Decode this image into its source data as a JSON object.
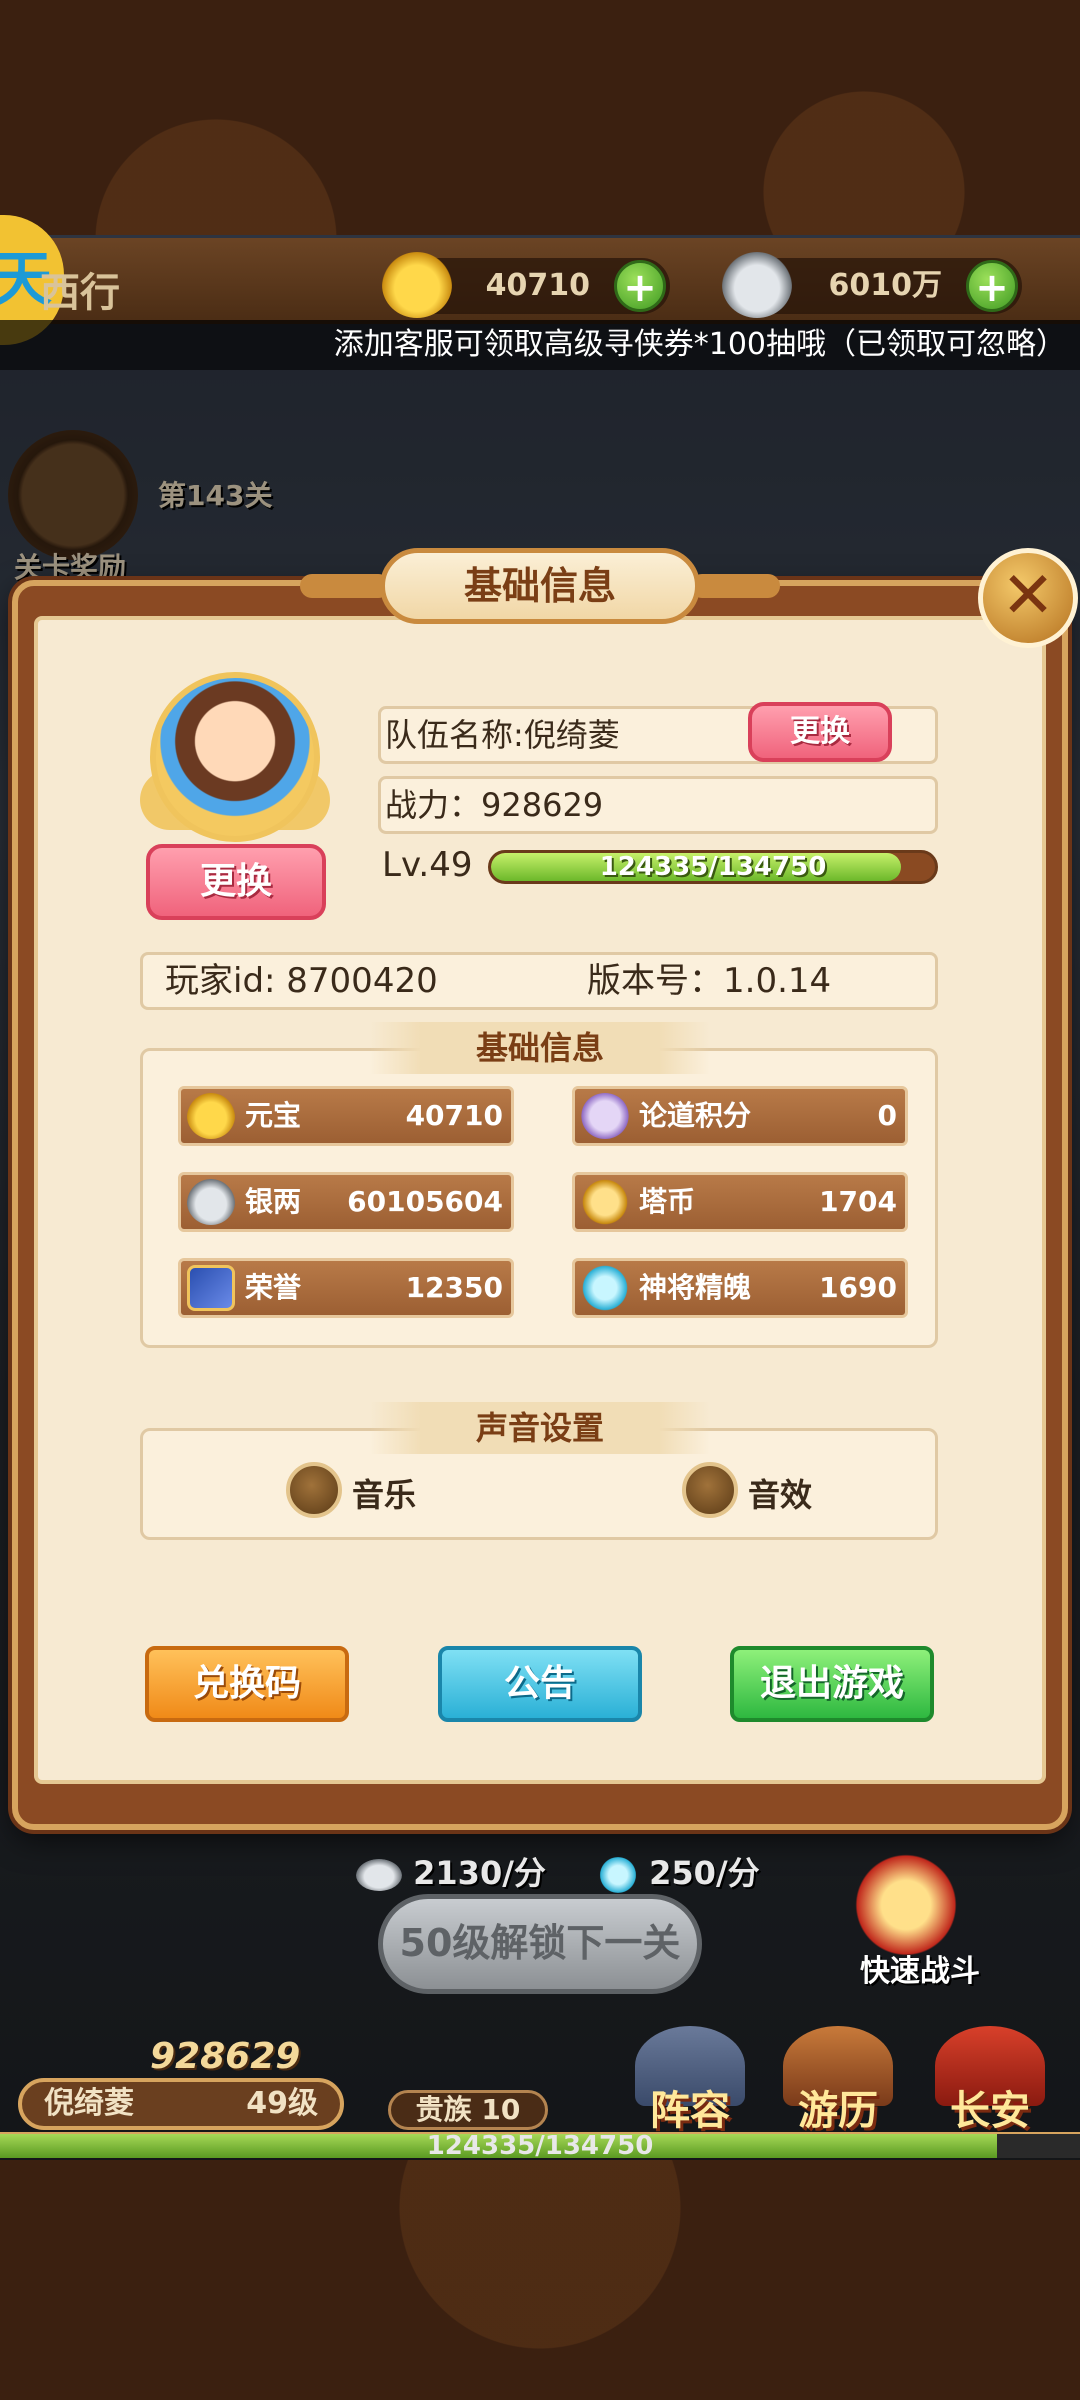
{
  "top_bar": {
    "logo_char": "天",
    "game_name": "西行",
    "gold": "40710",
    "silver": "6010万",
    "plus": "+"
  },
  "notice": "添加客服可领取高级寻侠券*100抽哦（已领取可忽略）",
  "map": {
    "stage_label": "第143关",
    "reward_label": "关卡奖励"
  },
  "modal": {
    "title": "基础信息",
    "close": "✕",
    "avatar_change_label": "更换",
    "team_name": "队伍名称:倪绮菱",
    "team_change_label": "更换",
    "power": "战力：928629",
    "level": "Lv.49",
    "exp_text": "124335/134750",
    "exp_fraction": 0.9227,
    "player_id": "玩家id: 8700420",
    "version": "版本号：1.0.14",
    "section_basic": "基础信息",
    "resources": [
      {
        "name": "元宝",
        "value": "40710",
        "icon": "gold-ingot-icon"
      },
      {
        "name": "论道积分",
        "value": "0",
        "icon": "debate-points-icon"
      },
      {
        "name": "银两",
        "value": "60105604",
        "icon": "silver-ingot-icon"
      },
      {
        "name": "塔币",
        "value": "1704",
        "icon": "tower-coin-icon"
      },
      {
        "name": "荣誉",
        "value": "12350",
        "icon": "honor-icon"
      },
      {
        "name": "神将精魄",
        "value": "1690",
        "icon": "spirit-crystal-icon"
      }
    ],
    "section_sound": "声音设置",
    "music_label": "音乐",
    "sfx_label": "音效",
    "redeem_label": "兑换码",
    "announce_label": "公告",
    "exit_label": "退出游戏"
  },
  "hud": {
    "silver_rate": "2130/分",
    "exp_rate": "250/分",
    "unlock_label": "50级解锁下一关",
    "quick_battle": "快速战斗",
    "power": "928629",
    "player_name": "倪绮菱",
    "player_level": "49级",
    "noble": "贵族 10",
    "exp_text": "124335/134750",
    "exp_fraction": 0.9227,
    "nav": [
      {
        "label": "阵容",
        "icon": "formation-icon"
      },
      {
        "label": "游历",
        "icon": "travel-icon"
      },
      {
        "label": "长安",
        "icon": "city-icon"
      }
    ]
  },
  "colors": {
    "accent_brown": "#8b4a23",
    "panel_bg": "#f7ead2",
    "exp_green": "#6cb82a"
  }
}
